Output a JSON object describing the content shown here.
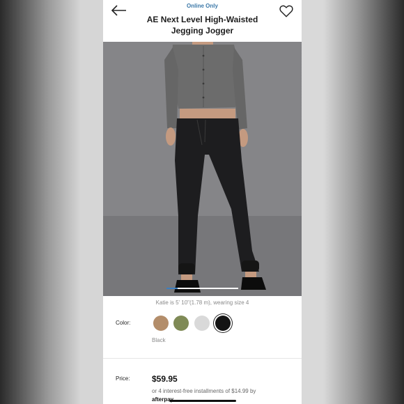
{
  "header": {
    "badge": "Online Only",
    "title": "AE Next Level High-Waisted Jegging Jogger"
  },
  "icons": {
    "back": "back-arrow-icon",
    "favorite": "heart-icon"
  },
  "gallery": {
    "current_index": 1,
    "image_alt": "Model wearing black jegging jogger with grey cropped cardigan"
  },
  "model_caption": "Katie is 5' 10\"(1.78 m), wearing size 4",
  "color": {
    "label": "Color:",
    "selected_name": "Black",
    "swatches": [
      {
        "name": "Tan",
        "hex": "#b38d6a"
      },
      {
        "name": "Olive",
        "hex": "#7f8a56"
      },
      {
        "name": "Light Grey",
        "hex": "#d9d9d9"
      },
      {
        "name": "Black",
        "hex": "#141414"
      }
    ]
  },
  "price": {
    "label": "Price:",
    "value": "$59.95",
    "installments_text": "or 4 interest-free installments of $14.99 by",
    "provider": "afterpay"
  },
  "colors": {
    "accent_blue": "#3b78a8",
    "text_dark": "#1e1e1e",
    "text_muted": "#8a8a8a"
  }
}
